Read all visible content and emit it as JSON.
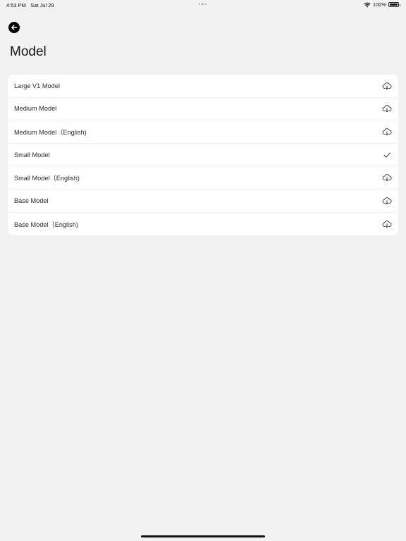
{
  "status_bar": {
    "time": "4:53 PM",
    "date": "Sat Jul 29",
    "battery": "100%",
    "wifi_icon": "wifi-icon",
    "battery_icon": "battery-icon"
  },
  "header": {
    "back_icon": "back-arrow-icon",
    "title": "Model"
  },
  "models": [
    {
      "label": "Large V1 Model",
      "state": "download",
      "icon": "cloud-download-icon"
    },
    {
      "label": "Medium Model",
      "state": "download",
      "icon": "cloud-download-icon"
    },
    {
      "label": "Medium Model（English)",
      "state": "download",
      "icon": "cloud-download-icon"
    },
    {
      "label": "Small Model",
      "state": "selected",
      "icon": "checkmark-icon"
    },
    {
      "label": "Small Model（English)",
      "state": "download",
      "icon": "cloud-download-icon"
    },
    {
      "label": "Base Model",
      "state": "download",
      "icon": "cloud-download-icon"
    },
    {
      "label": "Base Model（English)",
      "state": "download",
      "icon": "cloud-download-icon"
    }
  ]
}
